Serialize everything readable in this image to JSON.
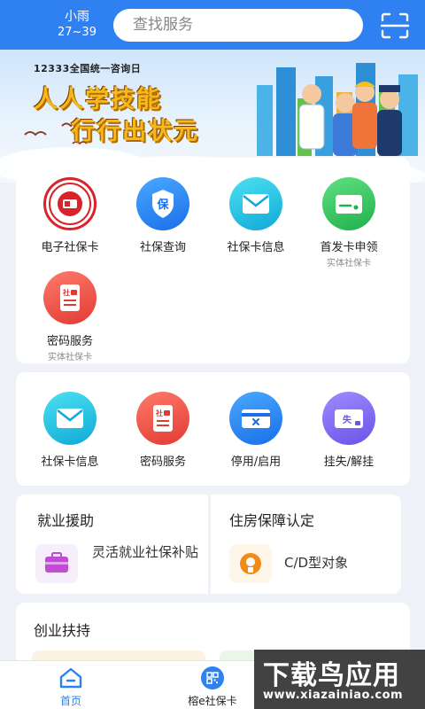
{
  "header": {
    "weather_condition": "小雨",
    "weather_temp": "27~39",
    "search_placeholder": "查找服务"
  },
  "banner": {
    "subtitle": "12333全国统一咨询日",
    "line1": "人人学技能",
    "line2": "行行出状元"
  },
  "services_top": [
    {
      "label": "电子社保卡",
      "sub": "",
      "icon": "social-security-card-icon"
    },
    {
      "label": "社保查询",
      "sub": "",
      "icon": "shield-bao-icon"
    },
    {
      "label": "社保卡信息",
      "sub": "",
      "icon": "envelope-icon"
    },
    {
      "label": "首发卡申领",
      "sub": "实体社保卡",
      "icon": "card-icon"
    },
    {
      "label": "密码服务",
      "sub": "实体社保卡",
      "icon": "password-doc-icon"
    }
  ],
  "services_mid": [
    {
      "label": "社保卡信息",
      "icon": "envelope-icon"
    },
    {
      "label": "密码服务",
      "icon": "password-doc-icon"
    },
    {
      "label": "停用/启用",
      "icon": "card-disable-icon"
    },
    {
      "label": "挂失/解挂",
      "icon": "card-lost-icon"
    }
  ],
  "employment": {
    "title": "就业援助",
    "item_label": "灵活就业社保补贴"
  },
  "housing": {
    "title": "住房保障认定",
    "item_label": "C/D型对象"
  },
  "startup": {
    "title": "创业扶持"
  },
  "nav": {
    "home_label": "首页",
    "card_label": "榕e社保卡"
  },
  "watermark": {
    "text": "下载鸟应用",
    "url": "www.xiazainiao.com"
  }
}
